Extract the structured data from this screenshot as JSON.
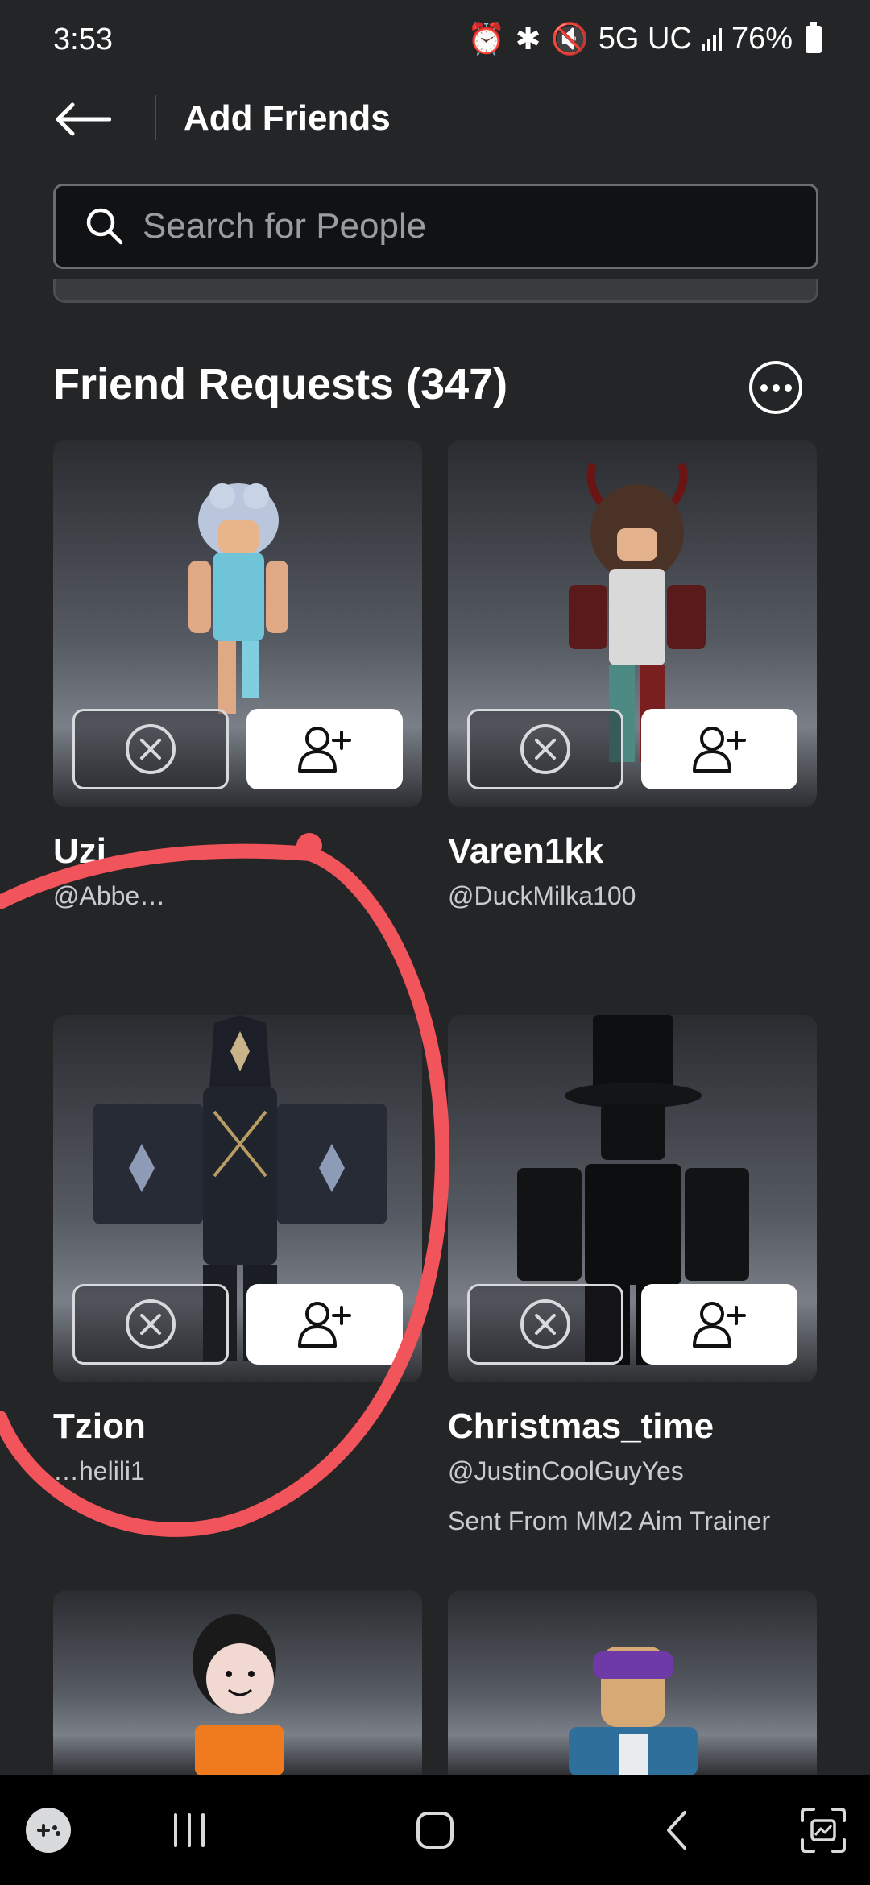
{
  "status_bar": {
    "time": "3:53",
    "network": "5G UC",
    "battery": "76%"
  },
  "header": {
    "title": "Add Friends"
  },
  "search": {
    "placeholder": "Search for People"
  },
  "friend_requests": {
    "title": "Friend Requests (347)",
    "cards": [
      {
        "name": "Uzi",
        "handle": "@Abbe…",
        "extra": ""
      },
      {
        "name": "Varen1kk",
        "handle": "@DuckMilka100",
        "extra": ""
      },
      {
        "name": "Tzion",
        "handle": "…helili1",
        "extra": ""
      },
      {
        "name": "Christmas_time",
        "handle": "@JustinCoolGuyYes",
        "extra": "Sent From MM2 Aim Trainer"
      }
    ]
  },
  "colors": {
    "background": "#232527",
    "annotation": "#f2545b",
    "accept_button": "#ffffff"
  },
  "icons": [
    "arrow-left-icon",
    "search-icon",
    "more-icon",
    "close-circle-icon",
    "person-add-icon",
    "recents-icon",
    "home-icon",
    "back-icon",
    "screenshot-icon",
    "game-launcher-icon"
  ]
}
